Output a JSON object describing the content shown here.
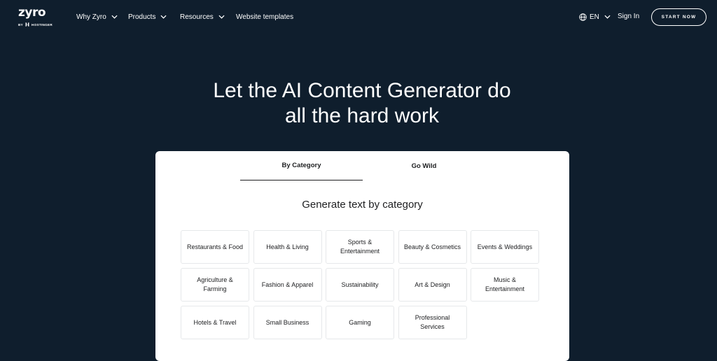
{
  "header": {
    "logo": {
      "word": "zyro",
      "sub": "BY HOSTINGER"
    },
    "nav": [
      {
        "label": "Why Zyro",
        "has_dropdown": true
      },
      {
        "label": "Products",
        "has_dropdown": true
      },
      {
        "label": "Resources",
        "has_dropdown": true
      },
      {
        "label": "Website templates",
        "has_dropdown": false
      }
    ],
    "language": {
      "icon": "globe-icon",
      "label": "EN"
    },
    "sign_in": "Sign In",
    "cta": "START NOW"
  },
  "hero": {
    "title_line1": "Let the AI Content Generator do",
    "title_line2": "all the hard work"
  },
  "card": {
    "tabs": [
      {
        "label": "By Category",
        "active": true
      },
      {
        "label": "Go Wild",
        "active": false
      }
    ],
    "heading": "Generate text by category",
    "categories": [
      "Restaurants & Food",
      "Health & Living",
      "Sports & Entertainment",
      "Beauty & Cosmetics",
      "Events & Weddings",
      "Agriculture & Farming",
      "Fashion & Apparel",
      "Sustainability",
      "Art & Design",
      "Music & Entertainment",
      "Hotels & Travel",
      "Small Business",
      "Gaming",
      "Professional Services"
    ]
  },
  "colors": {
    "background": "#0f1e2d",
    "card": "#ffffff",
    "text_dark": "#1d1e20",
    "tile_border": "#e6e8ea"
  }
}
